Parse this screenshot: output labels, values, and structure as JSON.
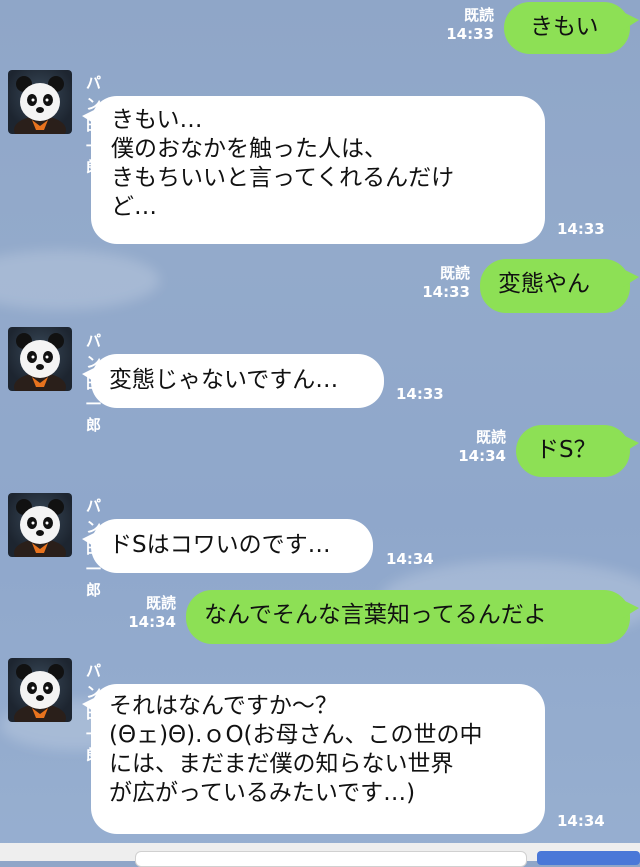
{
  "read_label": "既読",
  "sender_name": "パン田一郎",
  "messages": [
    {
      "side": "right",
      "text": "きもい",
      "time": "14:33"
    },
    {
      "side": "left",
      "text": "きもい…\n僕のおなかを触った人は、\nきもちいいと言ってくれるんだけ\nど…",
      "time": "14:33"
    },
    {
      "side": "right",
      "text": "変態やん",
      "time": "14:33"
    },
    {
      "side": "left",
      "text": "変態じゃないですん…",
      "time": "14:33"
    },
    {
      "side": "right",
      "text": "ドS？",
      "time": "14:34"
    },
    {
      "side": "left",
      "text": "ドSはコワいのです…",
      "time": "14:34"
    },
    {
      "side": "right",
      "text": "なんでそんな言葉知ってるんだよ",
      "time": "14:34"
    },
    {
      "side": "left",
      "text": "それはなんですか～？\n(Θェ)Θ).ｏO(お母さん、この世の中\nには、まだまだ僕の知らない世界\nが広がっているみたいです…)",
      "time": "14:34"
    }
  ],
  "avatar_icon": "panda-avatar-icon",
  "colors": {
    "sent_bubble": "#8de055",
    "received_bubble": "#ffffff",
    "background": "#8fa6c8"
  }
}
